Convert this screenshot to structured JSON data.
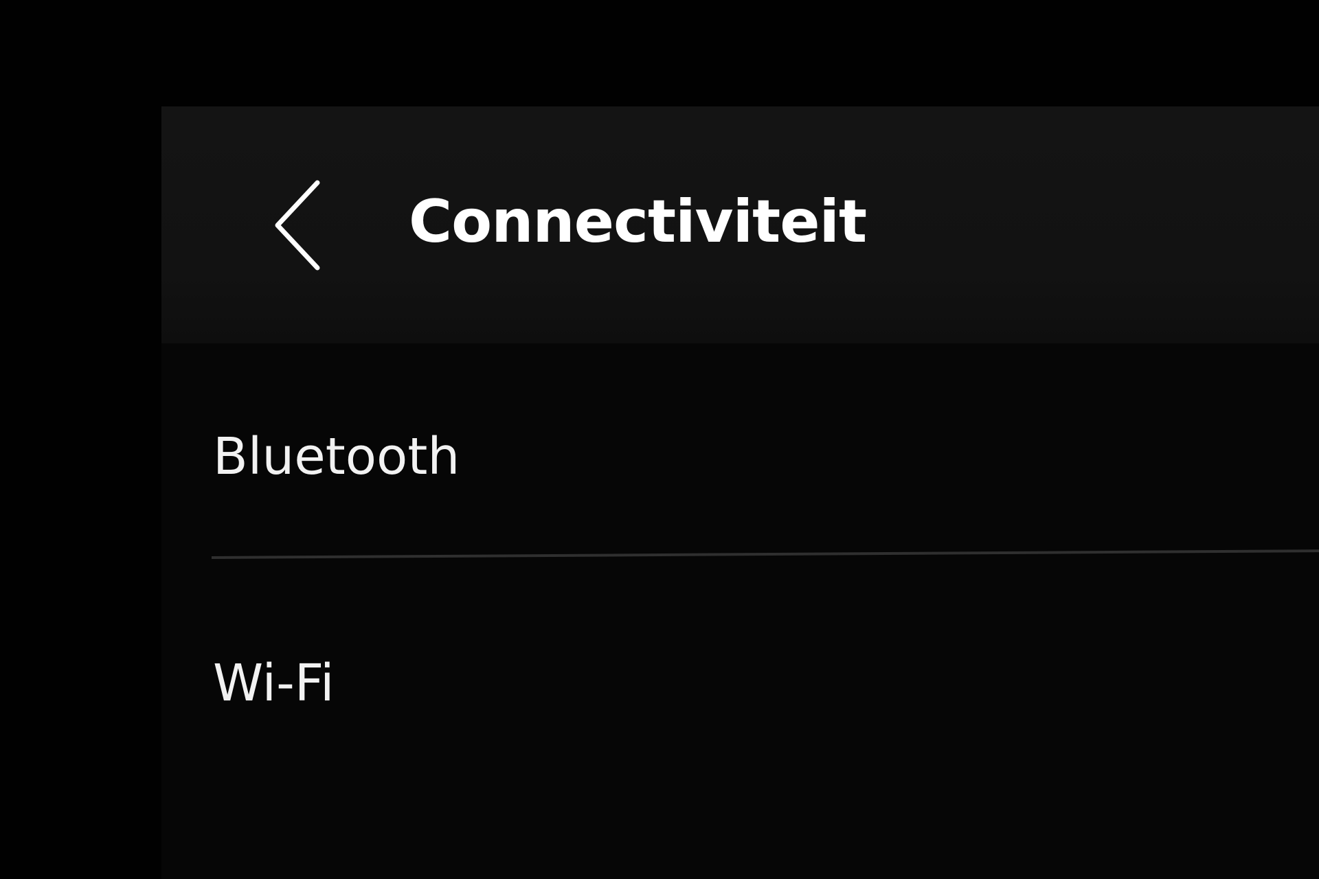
{
  "header": {
    "back_icon": "chevron-left-icon",
    "title": "Connectiviteit"
  },
  "list": {
    "items": [
      {
        "label": "Bluetooth"
      },
      {
        "label": "Wi-Fi"
      }
    ]
  },
  "colors": {
    "background": "#030303",
    "header_background": "#131313",
    "text": "#ffffff",
    "divider": "#2f2f2f"
  }
}
